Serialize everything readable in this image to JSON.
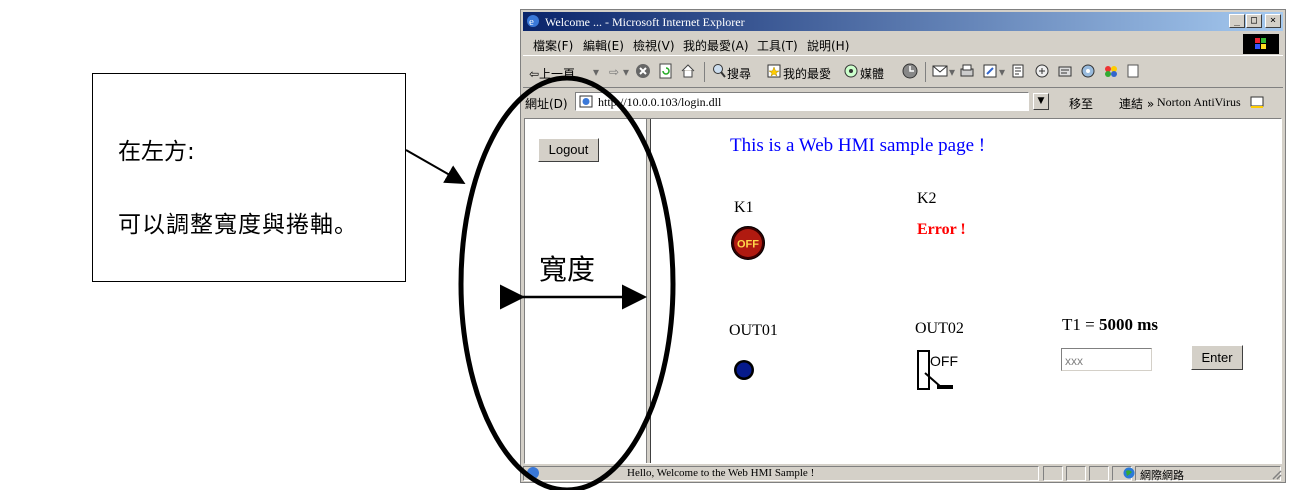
{
  "annotation": {
    "line1": "在左方:",
    "line2": "可以調整寬度與捲軸。",
    "width_label": "寬度"
  },
  "window": {
    "title": "Welcome ... - Microsoft Internet Explorer",
    "controls": {
      "minimize": "_",
      "maximize": "□",
      "close": "×"
    }
  },
  "menu": {
    "items": [
      "檔案(F)",
      "編輯(E)",
      "檢視(V)",
      "我的最愛(A)",
      "工具(T)",
      "說明(H)"
    ]
  },
  "toolbar": {
    "back": "⇦上一頁",
    "forward": "⇨",
    "search": "搜尋",
    "favorites": "我的最愛",
    "media": "媒體"
  },
  "address": {
    "label": "網址(D)",
    "url": "http://10.0.0.103/login.dll",
    "go": "移至",
    "links": "連結 »",
    "norton": "Norton AntiVirus"
  },
  "left_frame": {
    "logout": "Logout"
  },
  "hmi": {
    "title": "This is a Web HMI sample page !",
    "k1_label": "K1",
    "k1_state": "OFF",
    "k2_label": "K2",
    "k2_status": "Error !",
    "out01_label": "OUT01",
    "out02_label": "OUT02",
    "out02_state": "OFF",
    "t1_prefix": "T1 = ",
    "t1_value": "5000 ms",
    "t1_input": "xxx",
    "enter": "Enter"
  },
  "status": {
    "message": "Hello, Welcome to the Web HMI Sample !",
    "zone": "網際網路"
  },
  "colors": {
    "title_blue": "#0000ff",
    "error_red": "#ff0000",
    "win_gray": "#d4d0c8",
    "titlebar_dark": "#0a246a",
    "titlebar_light": "#a6caf0"
  }
}
